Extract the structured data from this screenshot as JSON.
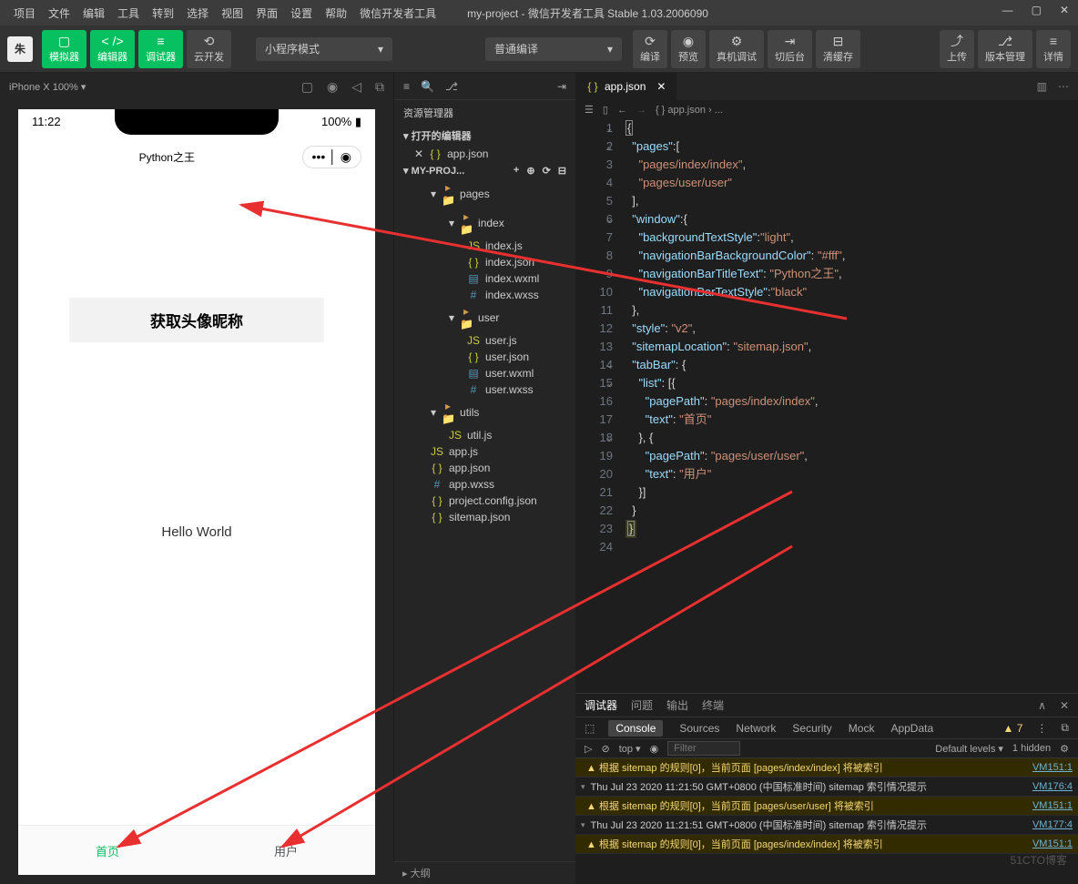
{
  "menu": {
    "items": [
      "项目",
      "文件",
      "编辑",
      "工具",
      "转到",
      "选择",
      "视图",
      "界面",
      "设置",
      "帮助",
      "微信开发者工具"
    ],
    "project": "my-project",
    "subtitle": "- 微信开发者工具 Stable 1.03.2006090"
  },
  "toolbar": {
    "buttons": [
      {
        "lbl": "模拟器",
        "g": true,
        "ico": "▢"
      },
      {
        "lbl": "编辑器",
        "g": true,
        "ico": "< />"
      },
      {
        "lbl": "调试器",
        "g": true,
        "ico": "≡"
      },
      {
        "lbl": "云开发",
        "g": false,
        "ico": "⟲"
      }
    ],
    "mode": "小程序模式",
    "compile": "普通编译",
    "right": [
      {
        "lbl": "编译",
        "ico": "⟳"
      },
      {
        "lbl": "预览",
        "ico": "◉"
      },
      {
        "lbl": "真机调试",
        "ico": "⚙"
      },
      {
        "lbl": "切后台",
        "ico": "⇥"
      },
      {
        "lbl": "清缓存",
        "ico": "⊟"
      }
    ],
    "far": [
      {
        "lbl": "上传",
        "ico": "⤴"
      },
      {
        "lbl": "版本管理",
        "ico": "⎇"
      },
      {
        "lbl": "详情",
        "ico": "≡"
      }
    ]
  },
  "simHead": {
    "device": "iPhone X 100% ▾"
  },
  "phone": {
    "time": "11:22",
    "battery": "100%",
    "title": "Python之王",
    "getBtn": "获取头像昵称",
    "hello": "Hello World",
    "tab1": "首页",
    "tab2": "用户"
  },
  "explorer": {
    "title": "资源管理器",
    "openEditors": "打开的编辑器",
    "openFile": "app.json",
    "project": "MY-PROJ...",
    "tree": [
      {
        "t": "pages",
        "i": "fold",
        "d": 0
      },
      {
        "t": "index",
        "i": "fold",
        "d": 1
      },
      {
        "t": "index.js",
        "i": "js",
        "d": 2
      },
      {
        "t": "index.json",
        "i": "json",
        "d": 2
      },
      {
        "t": "index.wxml",
        "i": "wxml",
        "d": 2
      },
      {
        "t": "index.wxss",
        "i": "wxss",
        "d": 2
      },
      {
        "t": "user",
        "i": "fold",
        "d": 1
      },
      {
        "t": "user.js",
        "i": "js",
        "d": 2
      },
      {
        "t": "user.json",
        "i": "json",
        "d": 2
      },
      {
        "t": "user.wxml",
        "i": "wxml",
        "d": 2
      },
      {
        "t": "user.wxss",
        "i": "wxss",
        "d": 2
      },
      {
        "t": "utils",
        "i": "fold",
        "d": 0
      },
      {
        "t": "util.js",
        "i": "js",
        "d": 1
      },
      {
        "t": "app.js",
        "i": "js",
        "d": 0
      },
      {
        "t": "app.json",
        "i": "json",
        "d": 0
      },
      {
        "t": "app.wxss",
        "i": "wxss",
        "d": 0
      },
      {
        "t": "project.config.json",
        "i": "json",
        "d": 0
      },
      {
        "t": "sitemap.json",
        "i": "json",
        "d": 0
      }
    ],
    "outline": "▸ 大纲"
  },
  "editor": {
    "tab": "app.json",
    "crumb": "{ } app.json › ...",
    "code": [
      {
        "n": 1,
        "f": "v",
        "h": "<span class='cur-br tok-p'>{</span>"
      },
      {
        "n": 2,
        "f": "v",
        "h": "  <span class='tok-k'>\"pages\"</span><span class='tok-p'>:[</span>"
      },
      {
        "n": 3,
        "f": "",
        "h": "    <span class='tok-s'>\"pages/index/index\"</span><span class='tok-p'>,</span>"
      },
      {
        "n": 4,
        "f": "",
        "h": "    <span class='tok-s'>\"pages/user/user\"</span>"
      },
      {
        "n": 5,
        "f": "",
        "h": "  <span class='tok-p'>],</span>"
      },
      {
        "n": 6,
        "f": "v",
        "h": "  <span class='tok-k'>\"window\"</span><span class='tok-p'>:{</span>"
      },
      {
        "n": 7,
        "f": "",
        "h": "    <span class='tok-k'>\"backgroundTextStyle\"</span><span class='tok-p'>:</span><span class='tok-s'>\"light\"</span><span class='tok-p'>,</span>"
      },
      {
        "n": 8,
        "f": "",
        "h": "    <span class='tok-k'>\"navigationBarBackgroundColor\"</span><span class='tok-p'>: </span><span class='tok-s'>\"#fff\"</span><span class='tok-p'>,</span>"
      },
      {
        "n": 9,
        "f": "",
        "h": "    <span class='tok-k'>\"navigationBarTitleText\"</span><span class='tok-p'>: </span><span class='tok-s'>\"Python之王\"</span><span class='tok-p'>,</span>"
      },
      {
        "n": 10,
        "f": "",
        "h": "    <span class='tok-k'>\"navigationBarTextStyle\"</span><span class='tok-p'>:</span><span class='tok-s'>\"black\"</span>"
      },
      {
        "n": 11,
        "f": "",
        "h": "  <span class='tok-p'>},</span>"
      },
      {
        "n": 12,
        "f": "",
        "h": "  <span class='tok-k'>\"style\"</span><span class='tok-p'>: </span><span class='tok-s'>\"v2\"</span><span class='tok-p'>,</span>"
      },
      {
        "n": 13,
        "f": "",
        "h": "  <span class='tok-k'>\"sitemapLocation\"</span><span class='tok-p'>: </span><span class='tok-s'>\"sitemap.json\"</span><span class='tok-p'>,</span>"
      },
      {
        "n": 14,
        "f": "v",
        "h": "  <span class='tok-k'>\"tabBar\"</span><span class='tok-p'>: {</span>"
      },
      {
        "n": 15,
        "f": "v",
        "h": "    <span class='tok-k'>\"list\"</span><span class='tok-p'>: [{</span>"
      },
      {
        "n": 16,
        "f": "",
        "h": "      <span class='tok-k'>\"pagePath\"</span><span class='tok-p'>: </span><span class='tok-s'>\"pages/index/index\"</span><span class='tok-p'>,</span>"
      },
      {
        "n": 17,
        "f": "",
        "h": "      <span class='tok-k'>\"text\"</span><span class='tok-p'>: </span><span class='tok-s'>\"首页\"</span>"
      },
      {
        "n": 18,
        "f": "v",
        "h": "    <span class='tok-p'>}, {</span>"
      },
      {
        "n": 19,
        "f": "",
        "h": "      <span class='tok-k'>\"pagePath\"</span><span class='tok-p'>: </span><span class='tok-s'>\"pages/user/user\"</span><span class='tok-p'>,</span>"
      },
      {
        "n": 20,
        "f": "",
        "h": "      <span class='tok-k'>\"text\"</span><span class='tok-p'>: </span><span class='tok-s'>\"用户\"</span>"
      },
      {
        "n": 21,
        "f": "",
        "h": "    <span class='tok-p'>}]</span>"
      },
      {
        "n": 22,
        "f": "",
        "h": "  <span class='tok-p'>}</span>"
      },
      {
        "n": 23,
        "f": "",
        "h": "<span class='hl-json'><span class='cur-br tok-p'>}</span></span>"
      },
      {
        "n": 24,
        "f": "",
        "h": ""
      }
    ]
  },
  "debug": {
    "tabs": [
      "调试器",
      "问题",
      "输出",
      "终端"
    ],
    "sub": [
      "Console",
      "Sources",
      "Network",
      "Security",
      "Mock",
      "AppData"
    ],
    "warnCount": "▲ 7",
    "top": "top",
    "filter": "Filter",
    "levels": "Default levels ▾",
    "hidden": "1 hidden",
    "logs": [
      {
        "type": "warn",
        "tri": "",
        "msg": "▲ 根据 sitemap 的规则[0]，当前页面 [pages/index/index] 将被索引",
        "link": "VM151:1"
      },
      {
        "type": "info",
        "tri": "▾",
        "msg": "Thu Jul 23 2020 11:21:50 GMT+0800 (中国标准时间) sitemap 索引情况提示",
        "link": "VM176:4"
      },
      {
        "type": "warn",
        "tri": "",
        "msg": "▲ 根据 sitemap 的规则[0]，当前页面 [pages/user/user] 将被索引",
        "link": "VM151:1"
      },
      {
        "type": "info",
        "tri": "▾",
        "msg": "Thu Jul 23 2020 11:21:51 GMT+0800 (中国标准时间) sitemap 索引情况提示",
        "link": "VM177:4"
      },
      {
        "type": "warn",
        "tri": "",
        "msg": "▲ 根据 sitemap 的规则[0]，当前页面 [pages/index/index] 将被索引",
        "link": "VM151:1"
      }
    ]
  },
  "watermark": "51CTO博客"
}
